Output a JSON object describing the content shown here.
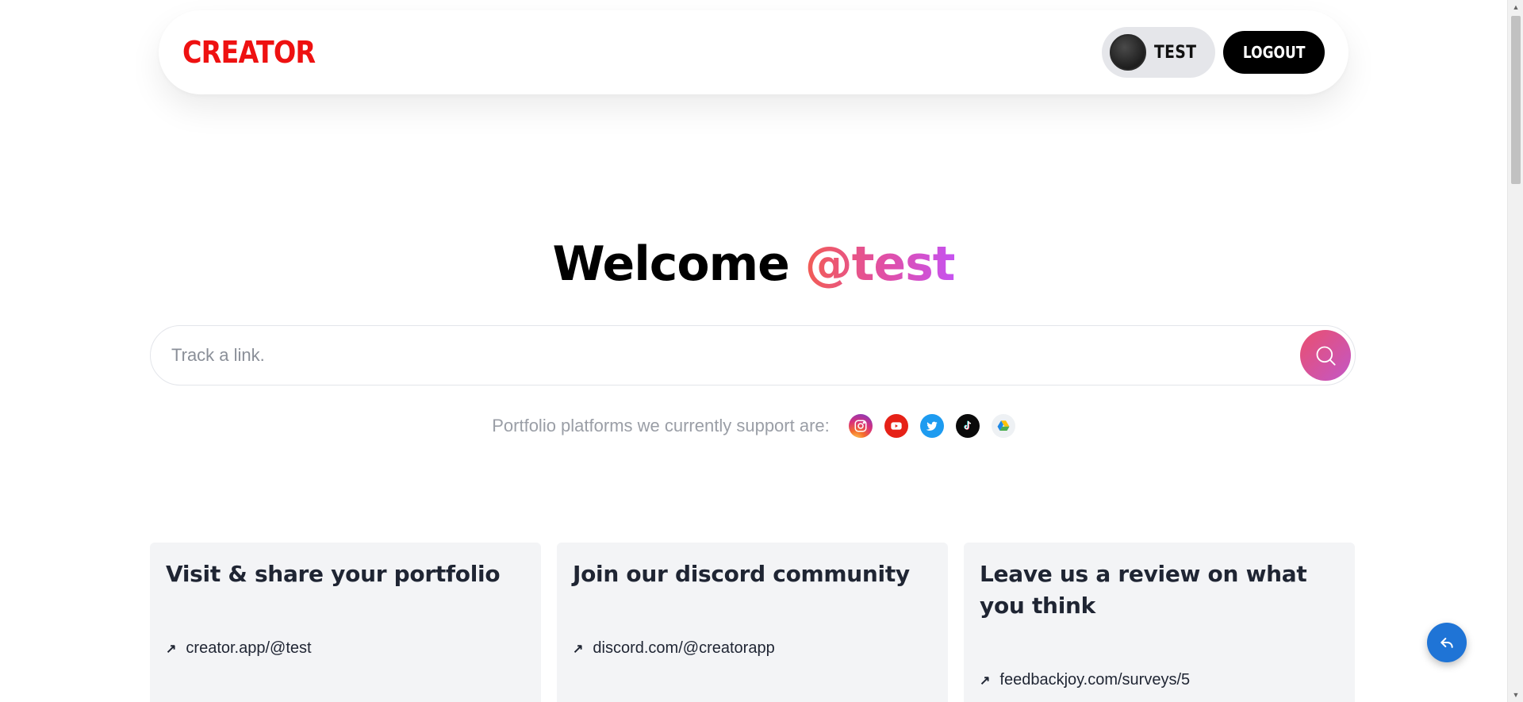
{
  "navbar": {
    "brand": "CREATOR",
    "user_name": "TEST",
    "logout_label": "LOGOUT"
  },
  "hero": {
    "welcome_text": "Welcome",
    "handle": "@test"
  },
  "search": {
    "placeholder": "Track a link."
  },
  "platforms": {
    "label": "Portfolio platforms we currently support are:",
    "icons": [
      "instagram-icon",
      "youtube-icon",
      "twitter-icon",
      "tiktok-icon",
      "google-drive-icon"
    ]
  },
  "cards": [
    {
      "title": "Visit & share your portfolio",
      "link": "creator.app/@test"
    },
    {
      "title": "Join our discord community",
      "link": "discord.com/@creatorapp"
    },
    {
      "title": "Leave us a review on what you think",
      "link": "feedbackjoy.com/surveys/5"
    }
  ],
  "colors": {
    "brand": "#ee1111",
    "handle_gradient": [
      "#f25c54",
      "#e04fa8",
      "#c653f0"
    ],
    "search_button_gradient": [
      "#ea4f6e",
      "#c357c7"
    ],
    "fab": "#1f74d6"
  },
  "fab": {
    "icon": "reply-icon"
  }
}
